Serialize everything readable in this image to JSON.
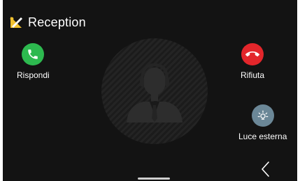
{
  "header": {
    "title": "Reception",
    "logo_icon": "wrench-pencil-logo"
  },
  "actions": {
    "answer": {
      "label": "Rispondi",
      "icon": "phone-icon",
      "color": "#2db94f"
    },
    "reject": {
      "label": "Rifiuta",
      "icon": "phone-hangup-icon",
      "color": "#e3262b"
    },
    "external_light": {
      "label": "Luce esterna",
      "icon": "light-bulb-icon",
      "color": "#6b8797"
    }
  },
  "caller": {
    "avatar_icon": "receptionist-avatar"
  },
  "navigation": {
    "back_icon": "chevron-left-icon",
    "home_indicator": "home-bar"
  }
}
